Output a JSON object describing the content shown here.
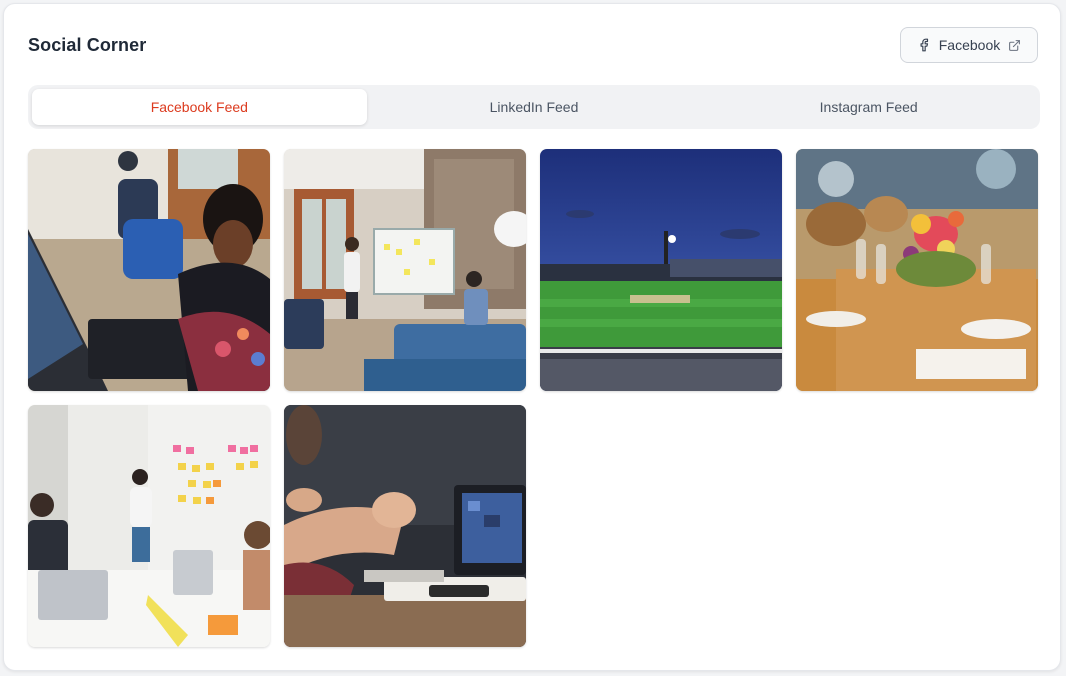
{
  "header": {
    "title": "Social Corner",
    "external_button_label": "Facebook"
  },
  "tabs": [
    {
      "label": "Facebook Feed",
      "active": true
    },
    {
      "label": "LinkedIn Feed",
      "active": false
    },
    {
      "label": "Instagram Feed",
      "active": false
    }
  ],
  "colors": {
    "accent": "#dc3b1f",
    "tab_bar": "#f1f2f4",
    "title": "#1f2937"
  },
  "feed": {
    "images": [
      {
        "name": "coworkers-laptop-photo"
      },
      {
        "name": "whiteboard-presentation-photo"
      },
      {
        "name": "cricket-stadium-photo"
      },
      {
        "name": "banquet-table-photo"
      },
      {
        "name": "sticky-notes-meeting-photo"
      },
      {
        "name": "laptop-hands-discussion-photo"
      }
    ]
  }
}
